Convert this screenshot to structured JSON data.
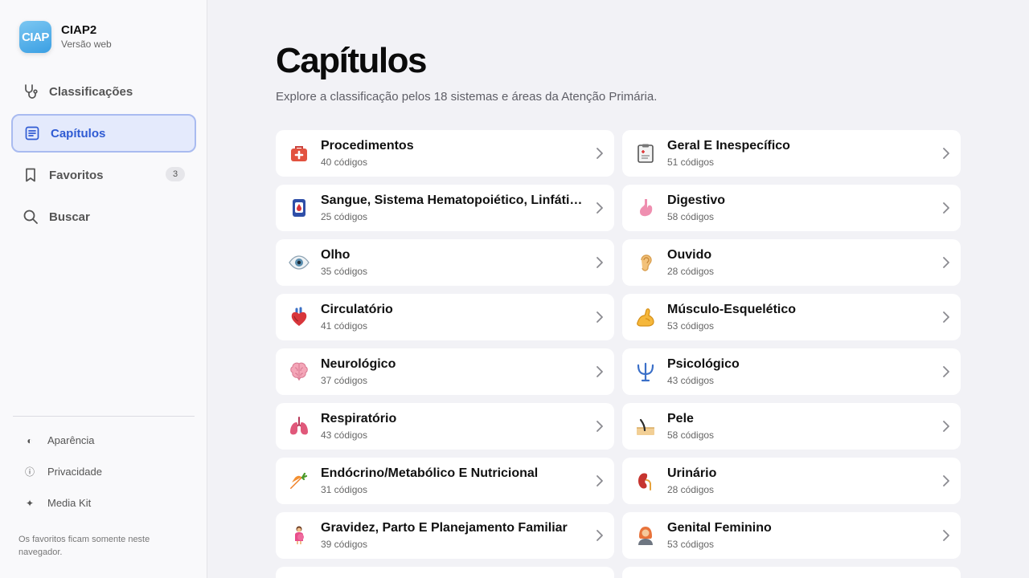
{
  "brand": {
    "logo_text": "CIAP",
    "title": "CIAP2",
    "subtitle": "Versão web"
  },
  "nav": [
    {
      "id": "classificacoes",
      "label": "Classificações",
      "icon": "stethoscope-icon",
      "active": false
    },
    {
      "id": "capitulos",
      "label": "Capítulos",
      "icon": "list-document-icon",
      "active": true
    },
    {
      "id": "favoritos",
      "label": "Favoritos",
      "icon": "bookmark-icon",
      "active": false,
      "badge": "3"
    },
    {
      "id": "buscar",
      "label": "Buscar",
      "icon": "search-icon",
      "active": false
    }
  ],
  "footer": {
    "links": [
      {
        "label": "Aparência",
        "icon": "contrast-icon",
        "glyph": "◐"
      },
      {
        "label": "Privacidade",
        "icon": "info-icon",
        "glyph": "ⓘ"
      },
      {
        "label": "Media Kit",
        "icon": "sparkle-icon",
        "glyph": "✦"
      }
    ],
    "note": "Os favoritos ficam somente neste navegador."
  },
  "main": {
    "title": "Capítulos",
    "subtitle": "Explore a classificação pelos 18 sistemas e áreas da Atenção Primária."
  },
  "chapters": [
    {
      "name": "Procedimentos",
      "count": "40 códigos",
      "icon": "first-aid-kit-icon"
    },
    {
      "name": "Geral E Inespecífico",
      "count": "51 códigos",
      "icon": "clipboard-icon"
    },
    {
      "name": "Sangue, Sistema Hematopoiético, Linfático e Baço",
      "count": "25 códigos",
      "icon": "blood-bag-icon"
    },
    {
      "name": "Digestivo",
      "count": "58 códigos",
      "icon": "stomach-icon"
    },
    {
      "name": "Olho",
      "count": "35 códigos",
      "icon": "eye-icon"
    },
    {
      "name": "Ouvido",
      "count": "28 códigos",
      "icon": "ear-icon"
    },
    {
      "name": "Circulatório",
      "count": "41 códigos",
      "icon": "heart-icon"
    },
    {
      "name": "Músculo-Esquelético",
      "count": "53 códigos",
      "icon": "flexed-arm-icon"
    },
    {
      "name": "Neurológico",
      "count": "37 códigos",
      "icon": "brain-icon"
    },
    {
      "name": "Psicológico",
      "count": "43 códigos",
      "icon": "psi-icon"
    },
    {
      "name": "Respiratório",
      "count": "43 códigos",
      "icon": "lungs-icon"
    },
    {
      "name": "Pele",
      "count": "58 códigos",
      "icon": "skin-hair-icon"
    },
    {
      "name": "Endócrino/Metabólico E Nutricional",
      "count": "31 códigos",
      "icon": "carrot-icon"
    },
    {
      "name": "Urinário",
      "count": "28 códigos",
      "icon": "kidney-icon"
    },
    {
      "name": "Gravidez, Parto E Planejamento Familiar",
      "count": "39 códigos",
      "icon": "pregnant-woman-icon"
    },
    {
      "name": "Genital Feminino",
      "count": "53 códigos",
      "icon": "woman-icon"
    }
  ],
  "colors": {
    "accent": "#2f5bd3",
    "active_bg": "#e4eafc",
    "page_bg": "#f2f2f6"
  }
}
